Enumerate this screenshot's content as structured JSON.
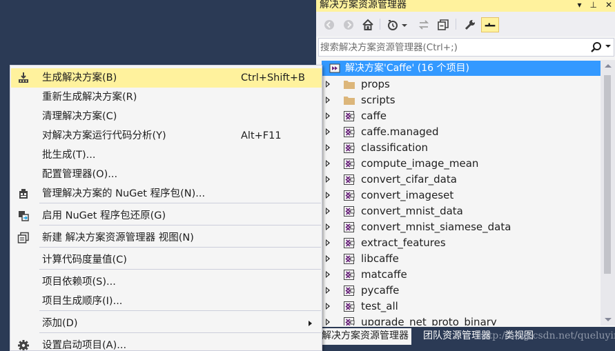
{
  "solution_explorer": {
    "title": "解决方案资源管理器",
    "title_buttons": [
      "▾",
      "⊥",
      "✕"
    ],
    "search_placeholder": "搜索解决方案资源管理器(Ctrl+;)",
    "root_label": "解决方案'Caffe' (16 个项目)",
    "nodes": [
      {
        "label": "props",
        "type": "folder"
      },
      {
        "label": "scripts",
        "type": "folder"
      },
      {
        "label": "caffe",
        "type": "project"
      },
      {
        "label": "caffe.managed",
        "type": "project"
      },
      {
        "label": "classification",
        "type": "project"
      },
      {
        "label": "compute_image_mean",
        "type": "project"
      },
      {
        "label": "convert_cifar_data",
        "type": "project"
      },
      {
        "label": "convert_imageset",
        "type": "project"
      },
      {
        "label": "convert_mnist_data",
        "type": "project"
      },
      {
        "label": "convert_mnist_siamese_data",
        "type": "project"
      },
      {
        "label": "extract_features",
        "type": "project"
      },
      {
        "label": "libcaffe",
        "type": "project"
      },
      {
        "label": "matcaffe",
        "type": "project"
      },
      {
        "label": "pycaffe",
        "type": "project"
      },
      {
        "label": "test_all",
        "type": "project"
      },
      {
        "label": "upgrade_net_proto_binary",
        "type": "project"
      }
    ],
    "tabs": [
      "解决方案资源管理器",
      "团队资源管理器",
      "类视图"
    ],
    "watermark": "http://blog.csdn.net/queluying"
  },
  "context_menu": {
    "items": [
      {
        "label": "生成解决方案(B)",
        "shortcut": "Ctrl+Shift+B",
        "icon": "build-icon"
      },
      {
        "label": "重新生成解决方案(R)"
      },
      {
        "label": "清理解决方案(C)"
      },
      {
        "label": "对解决方案运行代码分析(Y)",
        "shortcut": "Alt+F11"
      },
      {
        "label": "批生成(T)..."
      },
      {
        "label": "配置管理器(O)..."
      },
      {
        "label": "管理解决方案的 NuGet 程序包(N)...",
        "icon": "nuget-icon"
      },
      {
        "label": "启用 NuGet 程序包还原(G)",
        "icon": "package-restore-icon"
      },
      {
        "label": "新建 解决方案资源管理器 视图(N)",
        "icon": "new-view-icon"
      },
      {
        "label": "计算代码度量值(C)"
      },
      {
        "label": "项目依赖项(S)..."
      },
      {
        "label": "项目生成顺序(I)..."
      },
      {
        "label": "添加(D)"
      },
      {
        "label": "设置启动项目(A)...",
        "icon": "gear-icon"
      }
    ]
  },
  "colors": {
    "theme_background": "#2b3a55",
    "highlight": "#fff29d",
    "selection": "#3399ff"
  }
}
